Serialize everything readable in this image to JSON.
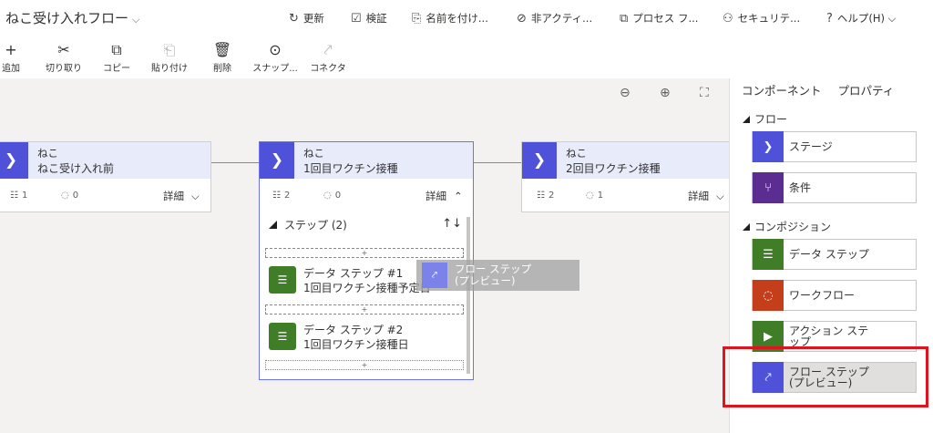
{
  "app": {
    "title": "ねこ受け入れフロー",
    "title_chevron": "⌵"
  },
  "commands": [
    {
      "name": "refresh",
      "icon": "↻",
      "label": "更新"
    },
    {
      "name": "validate",
      "icon": "☑",
      "label": "検証"
    },
    {
      "name": "save-as",
      "icon": "⎘",
      "label": "名前を付け..."
    },
    {
      "name": "deactivate",
      "icon": "⊘",
      "label": "非アクティ..."
    },
    {
      "name": "process",
      "icon": "⧉",
      "label": "プロセス フ..."
    },
    {
      "name": "security",
      "icon": "⚇",
      "label": "セキュリテ..."
    },
    {
      "name": "help",
      "icon": "?",
      "label": "ヘルプ(H) ⌵"
    }
  ],
  "toolbar": [
    {
      "name": "add",
      "icon": "+",
      "label": "追加",
      "disabled": false
    },
    {
      "name": "cut",
      "icon": "✂",
      "label": "切り取り",
      "disabled": false
    },
    {
      "name": "copy",
      "icon": "⧉",
      "label": "コピー",
      "disabled": false
    },
    {
      "name": "paste",
      "icon": "⎗",
      "label": "貼り付け",
      "disabled": true
    },
    {
      "name": "delete",
      "icon": "🗑",
      "label": "削除",
      "disabled": false
    },
    {
      "name": "snapshot",
      "icon": "⊙",
      "label": "スナップ...",
      "disabled": false
    },
    {
      "name": "connector",
      "icon": "⤤",
      "label": "コネクタ",
      "disabled": true
    }
  ],
  "zoom": {
    "zoom_out": "⊖",
    "zoom_in": "⊕",
    "fit": "⛶"
  },
  "stages": [
    {
      "category": "ねこ",
      "name": "ねこ受け入れ前",
      "steps_count": "1",
      "conditions_count": "0",
      "detail_label": "詳細",
      "expanded": false
    },
    {
      "category": "ねこ",
      "name": "1回目ワクチン接種",
      "steps_count": "2",
      "conditions_count": "0",
      "detail_label": "詳細",
      "expanded": true
    },
    {
      "category": "ねこ",
      "name": "2回目ワクチン接種",
      "steps_count": "2",
      "conditions_count": "1",
      "detail_label": "詳細",
      "expanded": false
    }
  ],
  "steps_section": {
    "title": "ステップ (2)",
    "sort_icon": "↑↓",
    "drop_marker": "+",
    "items": [
      {
        "title": "データ ステップ #1",
        "field": "1回目ワクチン接種予定日"
      },
      {
        "title": "データ ステップ #2",
        "field": "1回目ワクチン接種日"
      }
    ]
  },
  "drag_ghost": {
    "line1": "フロー ステップ",
    "line2": "(プレビュー)"
  },
  "panel": {
    "tab_components": "コンポーネント",
    "tab_properties": "プロパティ",
    "groups": [
      {
        "label": "フロー",
        "items": [
          {
            "name": "stage",
            "label": "ステージ",
            "line2": "",
            "color": "#4f52d8",
            "icon": "❯"
          },
          {
            "name": "condition",
            "label": "条件",
            "line2": "",
            "color": "#5c2d91",
            "icon": "⑂"
          }
        ]
      },
      {
        "label": "コンポジション",
        "items": [
          {
            "name": "data-step",
            "label": "データ ステップ",
            "line2": "",
            "color": "#3f7d27",
            "icon": "☰"
          },
          {
            "name": "workflow",
            "label": "ワークフロー",
            "line2": "",
            "color": "#c43e1c",
            "icon": "◌"
          },
          {
            "name": "action-step",
            "label": "アクション ステ",
            "line2": "ップ",
            "color": "#3f7d27",
            "icon": "▶"
          },
          {
            "name": "flow-step",
            "label": "フロー ステップ",
            "line2": "(プレビュー)",
            "color": "#4f52d8",
            "icon": "⤤"
          }
        ]
      }
    ]
  }
}
